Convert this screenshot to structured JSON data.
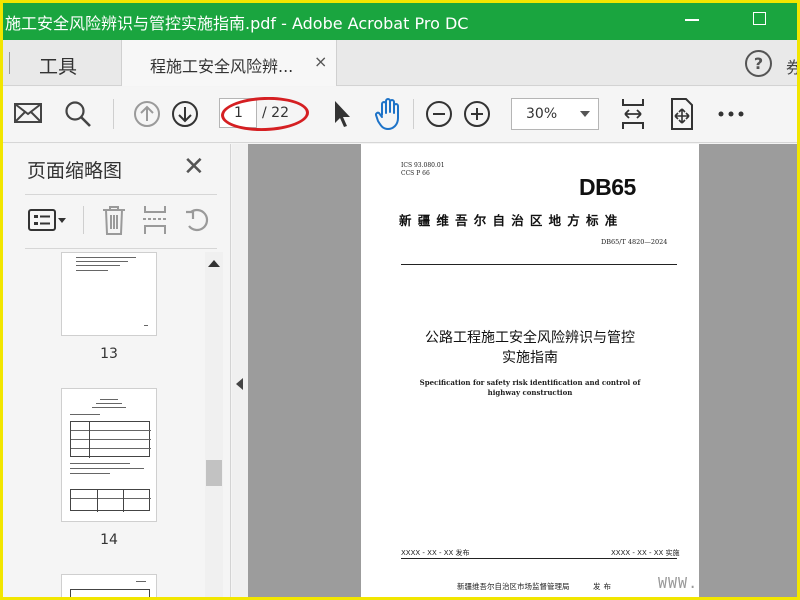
{
  "window": {
    "title": "施工安全风险辨识与管控实施指南.pdf - Adobe Acrobat Pro DC"
  },
  "tabs": {
    "tools_label": "工具",
    "doc_tab_label": "程施工安全风险辨...",
    "close_glyph": "×",
    "help_glyph": "?",
    "more_glyph": "券"
  },
  "toolbar": {
    "current_page": "1",
    "total_pages": "/ 22",
    "zoom": "30%"
  },
  "sidebar": {
    "title": "页面缩略图",
    "thumbnails": [
      {
        "label": "13"
      },
      {
        "label": "14"
      }
    ]
  },
  "document": {
    "ics": "ICS  93.080.01",
    "ccs": "CCS  P 66",
    "logo": "DB65",
    "standard_name": "新疆维吾尔自治区地方标准",
    "code": "DB65/T 4820—2024",
    "title_line1": "公路工程施工安全风险辨识与管控",
    "title_line2": "实施指南",
    "en_line1": "Specification for safety risk identification and control of",
    "en_line2": "highway construction",
    "release_date": "XXXX - XX - XX 发布",
    "impl_date": "XXXX - XX - XX 实施",
    "issuer": "新疆维吾尔自治区市场监督管理局",
    "issued": "发布"
  },
  "watermark": "WWW.",
  "colors": {
    "titlebar": "#1aa53f",
    "highlight_oval": "#d51f22",
    "frame": "#f2e600"
  }
}
